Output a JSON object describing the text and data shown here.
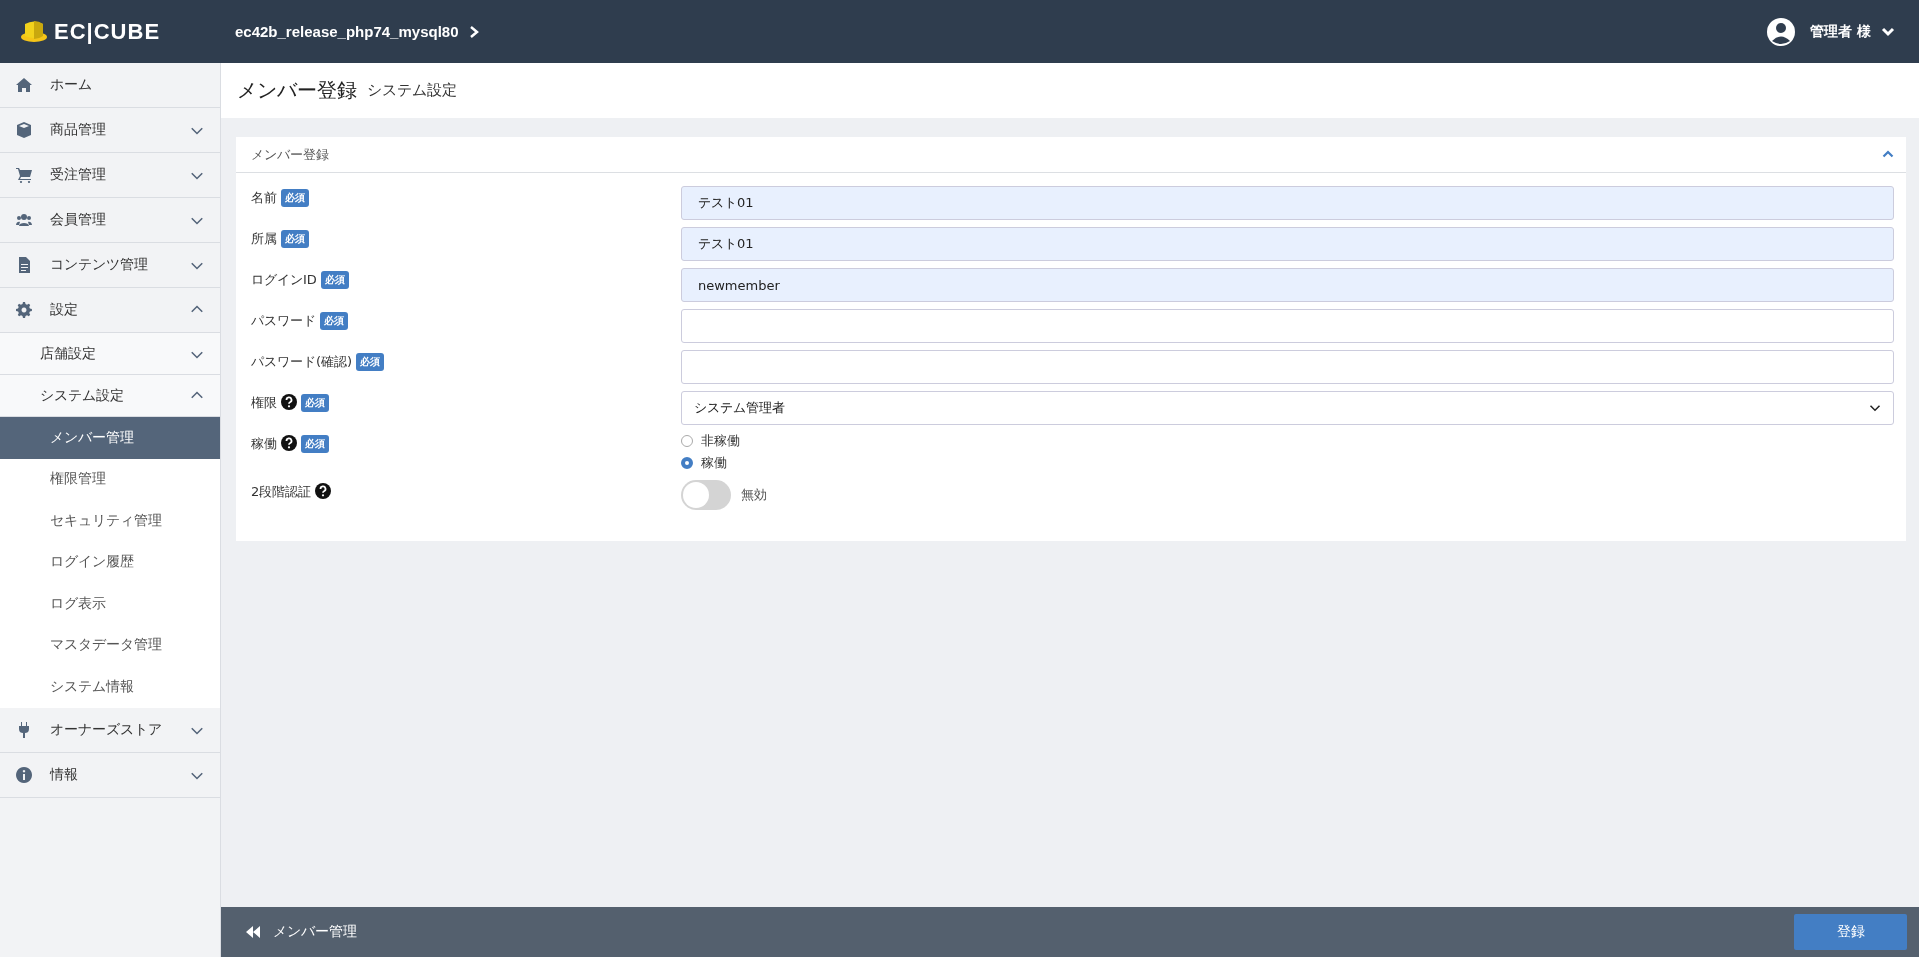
{
  "header": {
    "logo": "EC|CUBE",
    "shop_name": "ec42b_release_php74_mysql80",
    "user": "管理者 様"
  },
  "sidebar": {
    "items": [
      {
        "label": "ホーム",
        "expandable": false
      },
      {
        "label": "商品管理",
        "expanded": false,
        "expandable": true
      },
      {
        "label": "受注管理",
        "expanded": false,
        "expandable": true
      },
      {
        "label": "会員管理",
        "expanded": false,
        "expandable": true
      },
      {
        "label": "コンテンツ管理",
        "expanded": false,
        "expandable": true
      },
      {
        "label": "設定",
        "expanded": true,
        "expandable": true,
        "children": [
          {
            "label": "店舗設定",
            "expanded": false
          },
          {
            "label": "システム設定",
            "expanded": true,
            "children": [
              {
                "label": "メンバー管理",
                "selected": true
              },
              {
                "label": "権限管理",
                "selected": false
              },
              {
                "label": "セキュリティ管理",
                "selected": false
              },
              {
                "label": "ログイン履歴",
                "selected": false
              },
              {
                "label": "ログ表示",
                "selected": false
              },
              {
                "label": "マスタデータ管理",
                "selected": false
              },
              {
                "label": "システム情報",
                "selected": false
              }
            ]
          }
        ]
      },
      {
        "label": "オーナーズストア",
        "expanded": false,
        "expandable": true
      },
      {
        "label": "情報",
        "expanded": false,
        "expandable": true
      }
    ]
  },
  "page": {
    "title": "メンバー登録",
    "subtitle": "システム設定"
  },
  "card": {
    "title": "メンバー登録",
    "expanded": true,
    "fields": [
      {
        "kind": "text",
        "label": "名前",
        "required": true,
        "help": false,
        "required_badge": "必須",
        "value": "テスト01",
        "autofilled": true
      },
      {
        "kind": "text",
        "label": "所属",
        "required": true,
        "help": false,
        "required_badge": "必須",
        "value": "テスト01",
        "autofilled": true
      },
      {
        "kind": "text",
        "label": "ログインID",
        "required": true,
        "help": false,
        "required_badge": "必須",
        "value": "newmember",
        "autofilled": true
      },
      {
        "kind": "text",
        "label": "パスワード",
        "required": true,
        "help": false,
        "required_badge": "必須",
        "autofilled": false
      },
      {
        "kind": "text",
        "label": "パスワード(確認)",
        "required": true,
        "help": false,
        "required_badge": "必須",
        "autofilled": false
      },
      {
        "kind": "select",
        "label": "権限",
        "required": true,
        "help": true,
        "required_badge": "必須",
        "value": "システム管理者"
      },
      {
        "kind": "radio",
        "label": "稼働",
        "required": true,
        "help": true,
        "required_badge": "必須",
        "options": [
          {
            "label": "非稼働",
            "selected": false
          },
          {
            "label": "稼働",
            "selected": true
          }
        ]
      },
      {
        "kind": "toggle",
        "label": "2段階認証",
        "required": false,
        "help": true,
        "on": false,
        "state_label": "無効"
      }
    ]
  },
  "footer": {
    "back_label": "メンバー管理",
    "submit": "登録"
  }
}
